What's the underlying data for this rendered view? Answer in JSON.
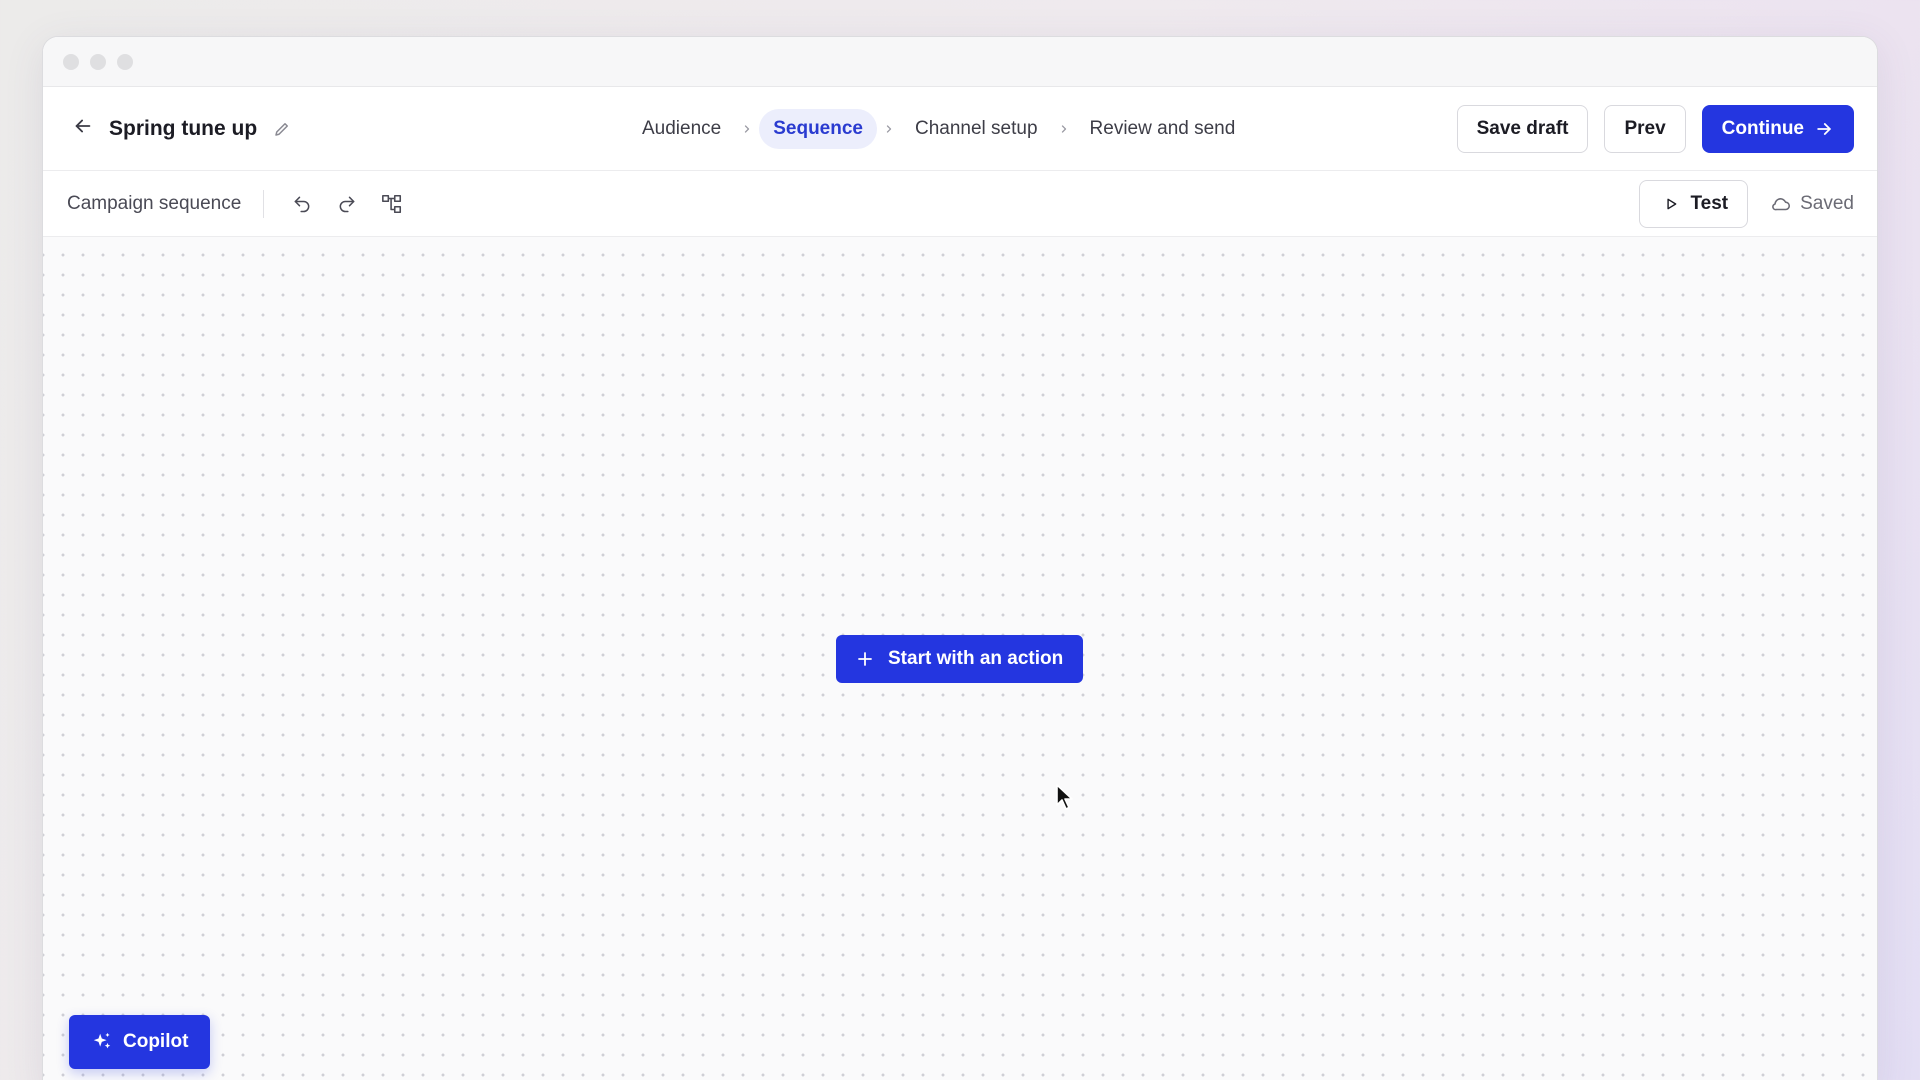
{
  "header": {
    "campaign_name": "Spring tune up",
    "steps": [
      {
        "label": "Audience",
        "active": false
      },
      {
        "label": "Sequence",
        "active": true
      },
      {
        "label": "Channel setup",
        "active": false
      },
      {
        "label": "Review and send",
        "active": false
      }
    ],
    "save_draft_label": "Save draft",
    "prev_label": "Prev",
    "continue_label": "Continue"
  },
  "toolbar": {
    "title": "Campaign sequence",
    "test_label": "Test",
    "status_label": "Saved"
  },
  "canvas": {
    "start_action_label": "Start with an action"
  },
  "copilot": {
    "label": "Copilot"
  },
  "colors": {
    "accent": "#2436e0",
    "active_step_bg": "#eceefc",
    "active_step_text": "#2a3bd0"
  },
  "icons": {
    "back": "arrow-left-icon",
    "edit": "pencil-icon",
    "undo": "undo-icon",
    "redo": "redo-icon",
    "layout": "tree-layout-icon",
    "test": "play-icon",
    "saved": "cloud-icon",
    "continue": "arrow-right-icon",
    "add": "plus-icon",
    "copilot": "sparkles-icon"
  }
}
